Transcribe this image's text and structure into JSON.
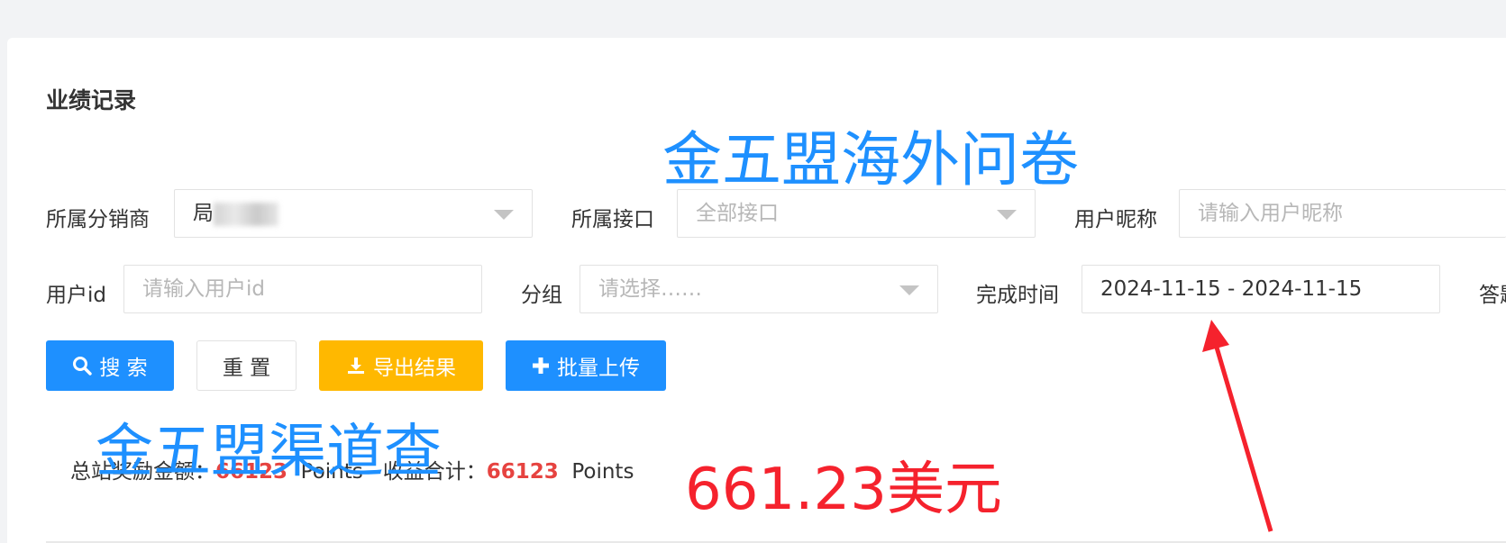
{
  "page_title": "业绩记录",
  "annotations": {
    "top": "金五盟海外问卷",
    "middle": "金五盟渠道查",
    "usd": "661.23美元"
  },
  "filters": {
    "distributor": {
      "label": "所属分销商",
      "value_prefix": "局"
    },
    "interface": {
      "label": "所属接口",
      "placeholder": "全部接口"
    },
    "nickname": {
      "label": "用户昵称",
      "placeholder": "请输入用户昵称"
    },
    "user_id": {
      "label": "用户id",
      "placeholder": "请输入用户id"
    },
    "group": {
      "label": "分组",
      "placeholder": "请选择……"
    },
    "finish_time": {
      "label": "完成时间",
      "value": "2024-11-15 - 2024-11-15"
    },
    "answer_label": "答题"
  },
  "buttons": {
    "search": "搜 索",
    "reset": "重 置",
    "export": "导出结果",
    "upload": "批量上传"
  },
  "summary": {
    "total_reward_label": "总站奖励金额：",
    "total_reward_value": "66123",
    "total_reward_unit": "Points",
    "income_label": "收益合计：",
    "income_value": "66123",
    "income_unit": "Points"
  },
  "colors": {
    "primary": "#1e90ff",
    "warning": "#ffb800",
    "danger": "#e64340",
    "annotation_red": "#f5222d"
  }
}
